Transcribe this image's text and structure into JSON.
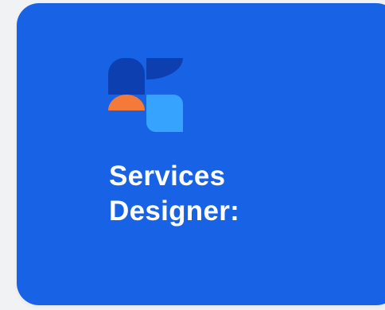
{
  "card": {
    "title_lines": [
      "Services",
      "Designer:"
    ]
  },
  "logo": {
    "icon": "services-designer-logo-icon",
    "colors": {
      "dark_blue": "#0e3fb0",
      "orange": "#f47a3a",
      "light_blue": "#36a4ff"
    }
  },
  "theme": {
    "background": "#f1f2f4",
    "card": "#1862e6",
    "text": "#ffffff"
  }
}
